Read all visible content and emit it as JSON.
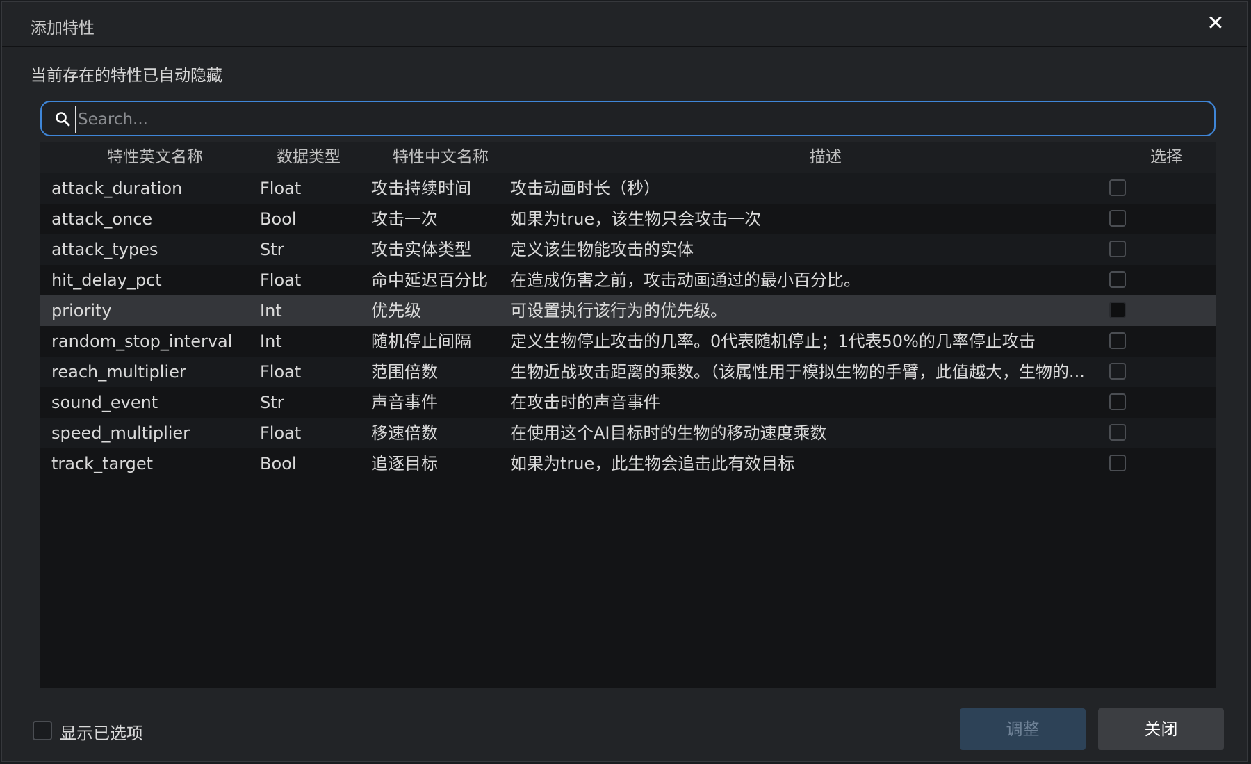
{
  "dialog": {
    "title": "添加特性",
    "close_symbol": "✕",
    "hint": "当前存在的特性已自动隐藏"
  },
  "search": {
    "placeholder": "Search...",
    "value": ""
  },
  "table": {
    "headers": {
      "name": "特性英文名称",
      "type": "数据类型",
      "cn_name": "特性中文名称",
      "desc": "描述",
      "select": "选择"
    },
    "rows": [
      {
        "name": "attack_duration",
        "type": "Float",
        "cn_name": "攻击持续时间",
        "desc": "攻击动画时长（秒）",
        "checked": false
      },
      {
        "name": "attack_once",
        "type": "Bool",
        "cn_name": "攻击一次",
        "desc": "如果为true，该生物只会攻击一次",
        "checked": false
      },
      {
        "name": "attack_types",
        "type": "Str",
        "cn_name": "攻击实体类型",
        "desc": "定义该生物能攻击的实体",
        "checked": false
      },
      {
        "name": "hit_delay_pct",
        "type": "Float",
        "cn_name": "命中延迟百分比",
        "desc": "在造成伤害之前，攻击动画通过的最小百分比。",
        "checked": false
      },
      {
        "name": "priority",
        "type": "Int",
        "cn_name": "优先级",
        "desc": "可设置执行该行为的优先级。",
        "checked": true
      },
      {
        "name": "random_stop_interval",
        "type": "Int",
        "cn_name": "随机停止间隔",
        "desc": "定义生物停止攻击的几率。0代表随机停止；1代表50%的几率停止攻击",
        "checked": false
      },
      {
        "name": "reach_multiplier",
        "type": "Float",
        "cn_name": "范围倍数",
        "desc": "生物近战攻击距离的乘数。（该属性用于模拟生物的手臂，此值越大，生物的...",
        "checked": false
      },
      {
        "name": "sound_event",
        "type": "Str",
        "cn_name": "声音事件",
        "desc": "在攻击时的声音事件",
        "checked": false
      },
      {
        "name": "speed_multiplier",
        "type": "Float",
        "cn_name": "移速倍数",
        "desc": "在使用这个AI目标时的生物的移动速度乘数",
        "checked": false
      },
      {
        "name": "track_target",
        "type": "Bool",
        "cn_name": "追逐目标",
        "desc": "如果为true，此生物会追击此有效目标",
        "checked": false
      }
    ]
  },
  "footer": {
    "show_selected_label": "显示已选项",
    "show_selected_checked": false,
    "adjust_label": "调整",
    "close_label": "关闭"
  },
  "colors": {
    "accent": "#3f86d8",
    "dialog_bg": "#222427",
    "table_bg": "#131416",
    "selected_row": "#34363a",
    "adjust_button_bg": "#2d4257",
    "close_button_bg": "#3c3e42"
  },
  "icons": {
    "close": "close-icon",
    "search": "search-icon"
  }
}
